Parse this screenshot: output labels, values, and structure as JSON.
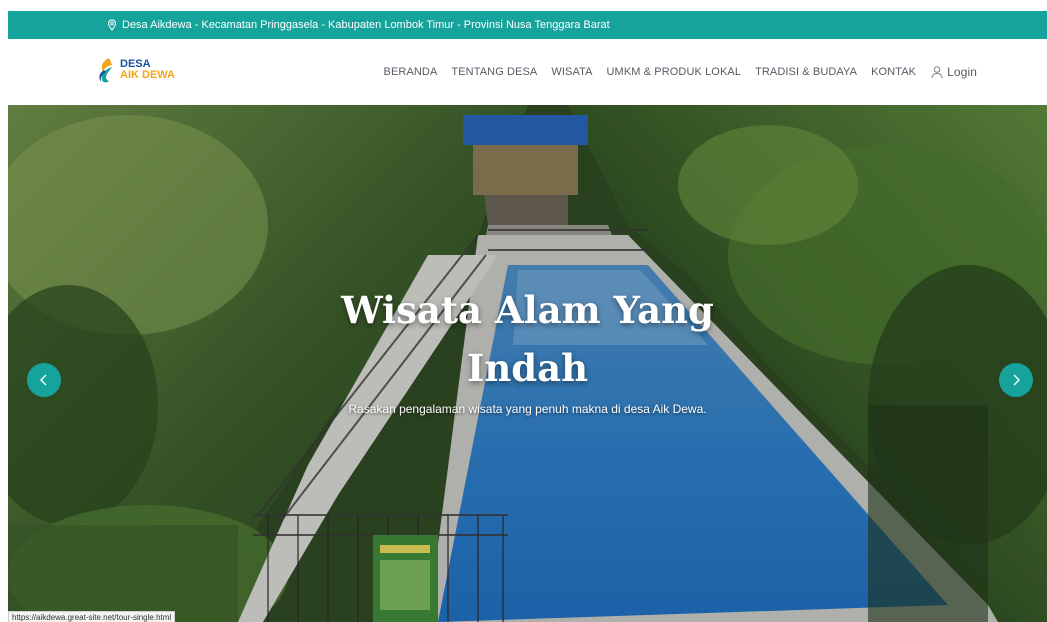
{
  "topbar": {
    "address": "Desa Aikdewa - Kecamatan Pringgasela - Kabupaten Lombok Timur - Provinsi Nusa Tenggara Barat",
    "icon": "location-pin-icon"
  },
  "brand": {
    "line1": "DESA",
    "line2": "AIK DEWA",
    "colors": {
      "primary": "#1b4f9c",
      "secondary": "#f2a41c",
      "accent": "#16a39c"
    }
  },
  "nav": {
    "items": [
      {
        "label": "BERANDA"
      },
      {
        "label": "TENTANG DESA"
      },
      {
        "label": "WISATA"
      },
      {
        "label": "UMKM & PRODUK LOKAL"
      },
      {
        "label": "TRADISI & BUDAYA"
      },
      {
        "label": "KONTAK"
      }
    ],
    "login_label": "Login",
    "login_icon": "user-icon"
  },
  "hero": {
    "title_line1": "Wisata Alam Yang",
    "title_line2": "Indah",
    "subtitle": "Rasakan pengalaman wisata yang penuh makna di desa Aik Dewa.",
    "prev_icon": "chevron-left-icon",
    "next_icon": "chevron-right-icon"
  },
  "status_bar": {
    "url": "https://aikdewa.great-site.net/tour-single.html"
  }
}
